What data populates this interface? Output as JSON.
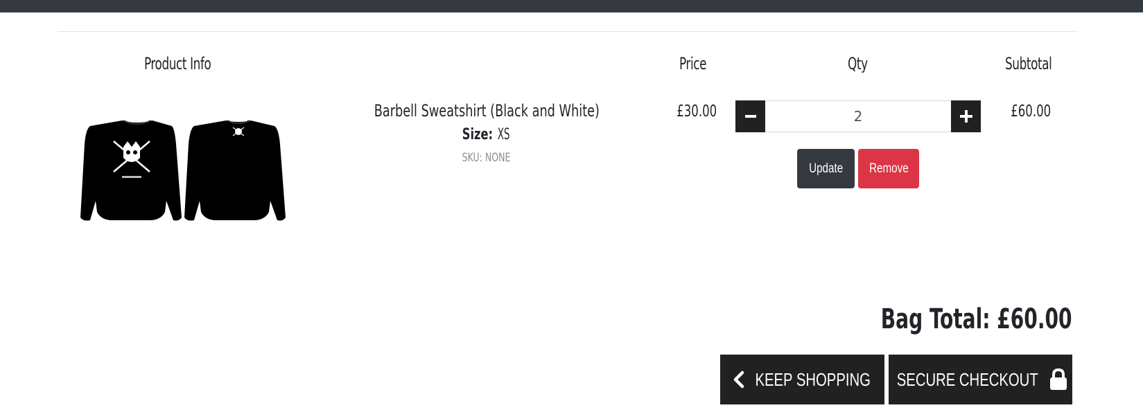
{
  "table": {
    "headers": {
      "product_info": "Product Info",
      "price": "Price",
      "qty": "Qty",
      "subtotal": "Subtotal"
    }
  },
  "item": {
    "image_icon": "sweatshirt-image",
    "name": "Barbell Sweatshirt (Black and White)",
    "size_label": "Size:",
    "size_value": "XS",
    "sku": "SKU: NONE",
    "price": "£30.00",
    "quantity": "2",
    "subtotal": "£60.00",
    "update_label": "Update",
    "remove_label": "Remove"
  },
  "summary": {
    "bag_total": "Bag Total: £60.00"
  },
  "actions": {
    "keep_shopping": "KEEP SHOPPING",
    "secure_checkout": "SECURE CHECKOUT"
  },
  "colors": {
    "topbar": "#343a40",
    "dark_button": "#212121",
    "update_button": "#343a40",
    "remove_button": "#dc3545"
  }
}
